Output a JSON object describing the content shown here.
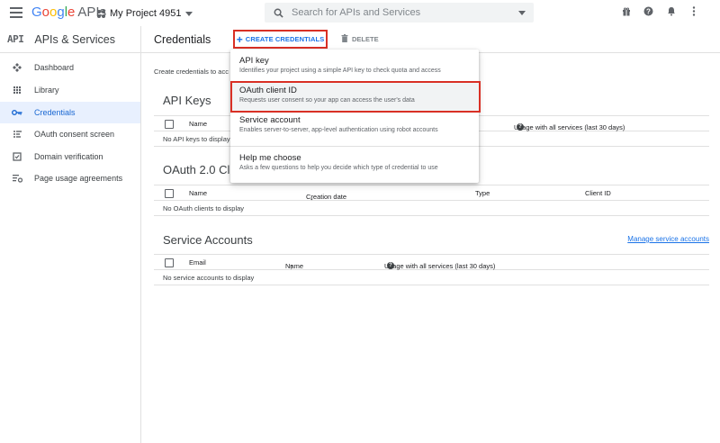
{
  "topbar": {
    "logo_google": [
      "G",
      "o",
      "o",
      "g",
      "l",
      "e"
    ],
    "logo_apis": "APIs",
    "project_name": "My Project 4951",
    "search_placeholder": "Search for APIs and Services"
  },
  "sidebar": {
    "app_badge": "API",
    "title": "APIs & Services",
    "items": [
      {
        "label": "Dashboard",
        "icon": "dashboard-icon"
      },
      {
        "label": "Library",
        "icon": "library-icon"
      },
      {
        "label": "Credentials",
        "icon": "key-icon",
        "active": true
      },
      {
        "label": "OAuth consent screen",
        "icon": "consent-screen-icon"
      },
      {
        "label": "Domain verification",
        "icon": "checkbox-icon"
      },
      {
        "label": "Page usage agreements",
        "icon": "settings-list-icon"
      }
    ]
  },
  "header": {
    "title": "Credentials",
    "create_label": "CREATE CREDENTIALS",
    "delete_label": "DELETE"
  },
  "content": {
    "intro": "Create credentials to acc",
    "api_keys": {
      "title": "API Keys",
      "col_name": "Name",
      "col_usage": "Usage with all services (last 30 days)",
      "empty": "No API keys to display"
    },
    "oauth": {
      "title": "OAuth 2.0 Clie",
      "col_name": "Name",
      "col_created": "Creation date",
      "col_type": "Type",
      "col_client": "Client ID",
      "empty": "No OAuth clients to display"
    },
    "service_accounts": {
      "title": "Service Accounts",
      "manage_link": "Manage service accounts",
      "col_email": "Email",
      "col_name": "Name",
      "col_usage": "Usage with all services (last 30 days)",
      "empty": "No service accounts to display"
    }
  },
  "dropdown": {
    "items": [
      {
        "title": "API key",
        "desc": "Identifies your project using a simple API key to check quota and access"
      },
      {
        "title": "OAuth client ID",
        "desc": "Requests user consent so your app can access the user's data"
      },
      {
        "title": "Service account",
        "desc": "Enables server-to-server, app-level authentication using robot accounts"
      },
      {
        "title": "Help me choose",
        "desc": "Asks a few questions to help you decide which type of credential to use"
      }
    ]
  },
  "colors": {
    "accent": "#1a73e8",
    "highlight": "#d93025",
    "active_bg": "#e8f0fe"
  }
}
